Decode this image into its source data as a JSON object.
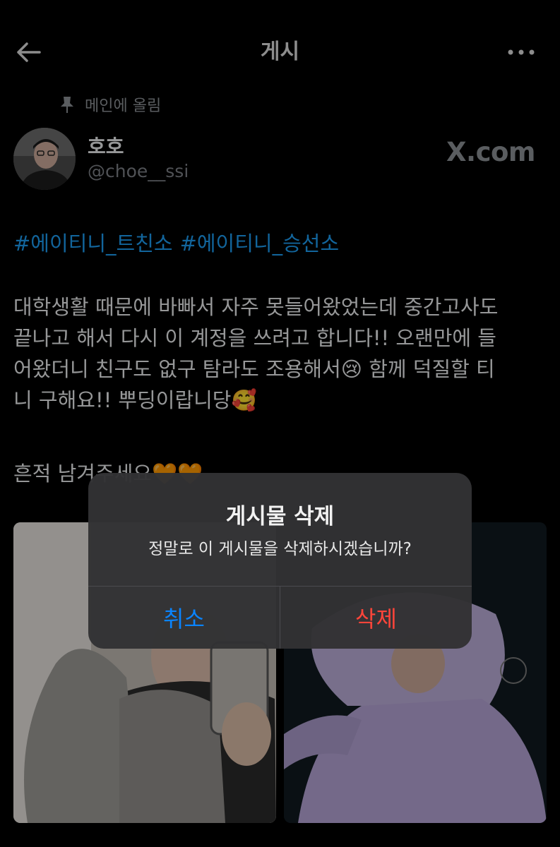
{
  "header": {
    "title": "게시",
    "back_icon": "arrow-left-icon",
    "more_icon": "more-horizontal-icon"
  },
  "pinned": {
    "label": "메인에 올림",
    "icon": "pin-icon"
  },
  "author": {
    "display_name": "호호",
    "handle": "@choe__ssi"
  },
  "watermark": "X.com",
  "post": {
    "hashtags": [
      "#에이티니_트친소",
      "#에이티니_승선소"
    ],
    "lines": [
      "대학생활 때문에 바빠서 자주 못들어왔었는데 중간고사도",
      "끝나고 해서 다시 이 계정을 쓰려고 합니다!! 오랜만에 들",
      "어왔더니 친구도 없구 탐라도 조용해서😢 함께 덕질할 티",
      "니 구해요!! 뿌딩이랍니당🥰"
    ],
    "trace_text": "흔적 남겨주세요🧡🧡"
  },
  "dialog": {
    "title": "게시물 삭제",
    "message": "정말로 이 게시물을 삭제하시겠습니까?",
    "cancel_label": "취소",
    "delete_label": "삭제"
  },
  "colors": {
    "background": "#000000",
    "hashtag": "#1d9bf0",
    "cancel": "#0a84ff",
    "delete": "#ff453a",
    "dialog_bg": "#323234"
  }
}
